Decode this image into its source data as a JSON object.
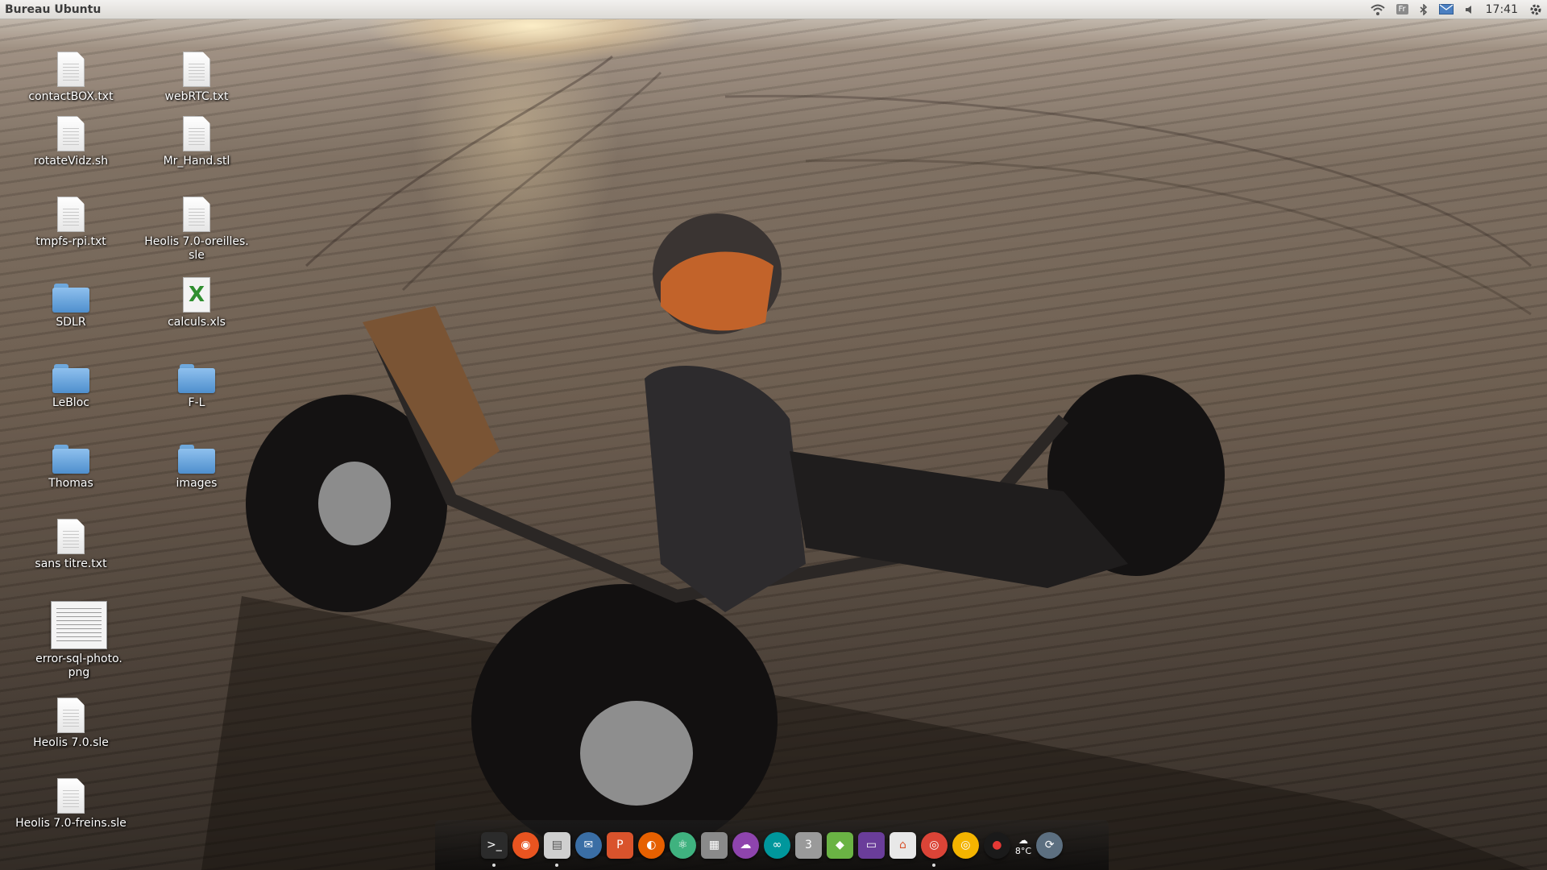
{
  "panel": {
    "title": "Bureau Ubuntu",
    "keyboard_layout": "Fr",
    "clock": "17:41",
    "indicators": [
      "wifi-icon",
      "keyboard-layout-indicator",
      "bluetooth-icon",
      "mail-icon",
      "volume-icon",
      "clock",
      "session-gear-icon"
    ]
  },
  "desktop": {
    "icons": [
      {
        "label": "contactBOX.txt",
        "type": "text-file-icon"
      },
      {
        "label": "webRTC.txt",
        "type": "text-file-icon"
      },
      {
        "label": "rotateVidz.sh",
        "type": "script-file-icon"
      },
      {
        "label": "Mr_Hand.stl",
        "type": "file-icon"
      },
      {
        "label": "tmpfs-rpi.txt",
        "type": "text-file-icon"
      },
      {
        "label": "Heolis 7.0-oreilles.\nsle",
        "type": "file-icon"
      },
      {
        "label": "SDLR",
        "type": "folder-icon"
      },
      {
        "label": "calculs.xls",
        "type": "spreadsheet-icon"
      },
      {
        "label": "LeBloc",
        "type": "folder-icon"
      },
      {
        "label": "F-L",
        "type": "folder-icon"
      },
      {
        "label": "Thomas",
        "type": "folder-icon"
      },
      {
        "label": "images",
        "type": "folder-icon"
      },
      {
        "label": "sans titre.txt",
        "type": "text-file-icon"
      },
      {
        "label": "error-sql-photo.\npng",
        "type": "image-thumbnail"
      },
      {
        "label": "Heolis 7.0.sle",
        "type": "file-icon"
      },
      {
        "label": "Heolis 7.0-freins.sle",
        "type": "file-icon"
      }
    ],
    "xls_glyph": "X"
  },
  "dock": {
    "items": [
      {
        "name": "terminal-icon",
        "color": "#2b2b2b",
        "glyph": ">_"
      },
      {
        "name": "ubuntu-software-icon",
        "color": "#e95420",
        "glyph": "◉"
      },
      {
        "name": "file-manager-icon",
        "color": "#cfcfcf",
        "glyph": "▤"
      },
      {
        "name": "thunderbird-icon",
        "color": "#3a6ea5",
        "glyph": "✉"
      },
      {
        "name": "presentation-icon",
        "color": "#d9532c",
        "glyph": "P"
      },
      {
        "name": "firefox-icon",
        "color": "#e66000",
        "glyph": "◐"
      },
      {
        "name": "atom-icon",
        "color": "#3fb27f",
        "glyph": "⚛"
      },
      {
        "name": "system-monitor-icon",
        "color": "#8a8a8a",
        "glyph": "▦"
      },
      {
        "name": "pidgin-icon",
        "color": "#8e44ad",
        "glyph": "☁"
      },
      {
        "name": "arduino-icon",
        "color": "#00979c",
        "glyph": "∞"
      },
      {
        "name": "trash-icon",
        "color": "#9a9a9a",
        "glyph": "3"
      },
      {
        "name": "android-studio-icon",
        "color": "#6ab344",
        "glyph": "◆"
      },
      {
        "name": "display-settings-icon",
        "color": "#6a3d9a",
        "glyph": "▭"
      },
      {
        "name": "remote-desktop-icon",
        "color": "#e8e8e8",
        "glyph": "⌂"
      },
      {
        "name": "chrome-icon",
        "color": "#db4437",
        "glyph": "◎"
      },
      {
        "name": "chrome-canary-icon",
        "color": "#f4b400",
        "glyph": "◎"
      },
      {
        "name": "recorder-icon",
        "color": "#1a1a1a",
        "glyph": "●"
      },
      {
        "name": "refresh-icon",
        "color": "#5c6f80",
        "glyph": "⟳"
      }
    ],
    "weather": {
      "temp": "8°C"
    }
  }
}
